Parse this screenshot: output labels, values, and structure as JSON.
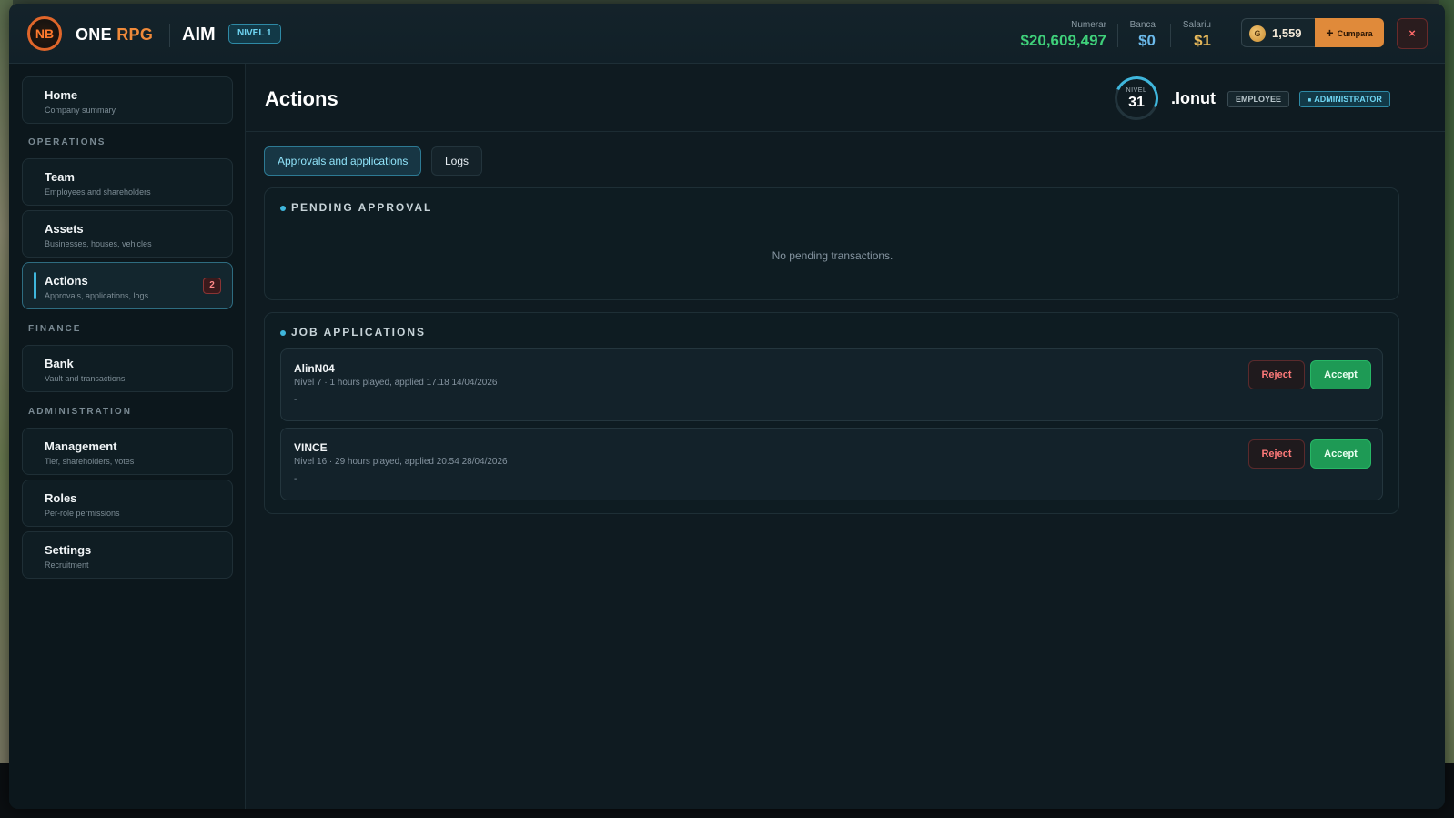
{
  "header": {
    "brand_one": "ONE",
    "brand_rpg": "RPG",
    "logo_text": "NB",
    "company": "AIM",
    "level_badge": "NIVEL 1",
    "stats": {
      "numerar_label": "Numerar",
      "numerar_value": "$20,609,497",
      "banca_label": "Banca",
      "banca_value": "$0",
      "salariu_label": "Salariu",
      "salariu_value": "$1"
    },
    "coin_symbol": "G",
    "coins": "1,559",
    "buy_label": "Cumpara",
    "buy_icon": "+",
    "close_icon": "×"
  },
  "sidebar": {
    "home": {
      "title": "Home",
      "subtitle": "Company summary"
    },
    "section_operations": "OPERATIONS",
    "team": {
      "title": "Team",
      "subtitle": "Employees and shareholders"
    },
    "assets": {
      "title": "Assets",
      "subtitle": "Businesses, houses, vehicles"
    },
    "actions": {
      "title": "Actions",
      "subtitle": "Approvals, applications, logs",
      "badge": "2"
    },
    "section_finance": "FINANCE",
    "bank": {
      "title": "Bank",
      "subtitle": "Vault and transactions"
    },
    "section_administration": "ADMINISTRATION",
    "management": {
      "title": "Management",
      "subtitle": "Tier, shareholders, votes"
    },
    "roles": {
      "title": "Roles",
      "subtitle": "Per-role permissions"
    },
    "settings": {
      "title": "Settings",
      "subtitle": "Recruitment"
    }
  },
  "main": {
    "title": "Actions",
    "user": {
      "level_label": "NIVEL",
      "level": "31",
      "name": ".Ionut",
      "role_employee": "EMPLOYEE",
      "role_admin": "ADMINISTRATOR",
      "role_admin_icon": "■"
    },
    "tabs": {
      "approvals": "Approvals and applications",
      "logs": "Logs"
    },
    "pending": {
      "title": "PENDING APPROVAL",
      "empty": "No pending transactions."
    },
    "jobs": {
      "title": "JOB APPLICATIONS",
      "items": [
        {
          "name": "AlinN04",
          "meta": "Nivel 7 · 1 hours played, applied 17.18 14/04/2026",
          "note": "-",
          "reject": "Reject",
          "accept": "Accept"
        },
        {
          "name": "VINCE",
          "meta": "Nivel 16 · 29 hours played, applied 20.54 28/04/2026",
          "note": "-",
          "reject": "Reject",
          "accept": "Accept"
        }
      ]
    }
  },
  "colors": {
    "accent": "#3fb6dc",
    "cash": "#3fd07a",
    "bank": "#6bb9ea",
    "salary": "#e6b85a",
    "buy": "#e08a3a",
    "accept": "#1e9a55",
    "reject": "#ff7a7a"
  }
}
